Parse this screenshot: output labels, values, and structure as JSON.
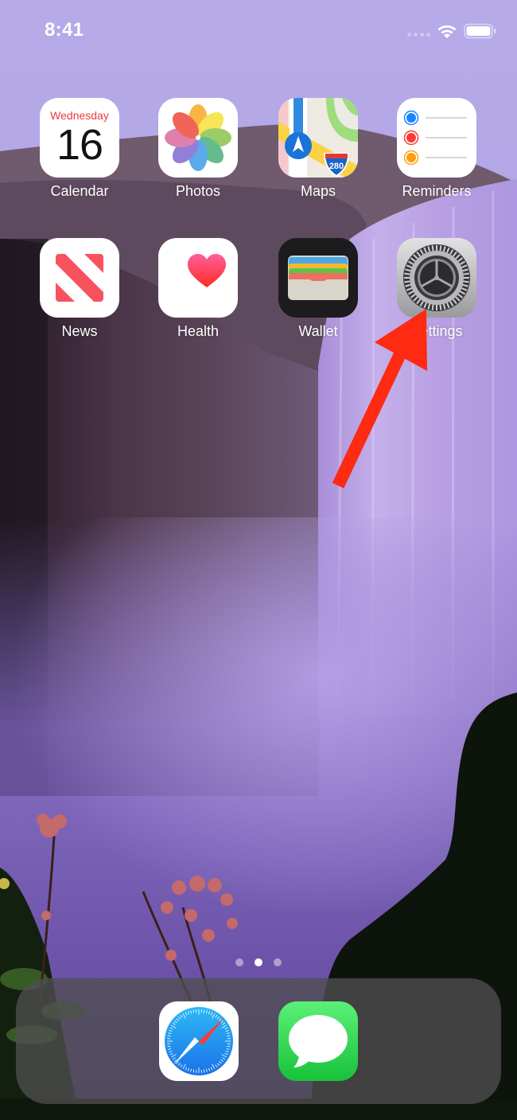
{
  "status_bar": {
    "time": "8:41",
    "signal_icon": "cellular-signal-icon",
    "wifi_icon": "wifi-icon",
    "battery_icon": "battery-icon",
    "battery_level": 1.0
  },
  "home_screen": {
    "apps": [
      {
        "label": "Calendar",
        "icon": "calendar-icon",
        "weekday": "Wednesday",
        "day": "16"
      },
      {
        "label": "Photos",
        "icon": "photos-icon"
      },
      {
        "label": "Maps",
        "icon": "maps-icon",
        "shield_text": "280"
      },
      {
        "label": "Reminders",
        "icon": "reminders-icon"
      },
      {
        "label": "News",
        "icon": "news-icon"
      },
      {
        "label": "Health",
        "icon": "health-icon"
      },
      {
        "label": "Wallet",
        "icon": "wallet-icon"
      },
      {
        "label": "Settings",
        "icon": "settings-icon"
      }
    ],
    "page_indicator": {
      "pages": 3,
      "current": 2
    }
  },
  "dock": {
    "apps": [
      {
        "label": "Safari",
        "icon": "safari-icon"
      },
      {
        "label": "Messages",
        "icon": "messages-icon"
      }
    ]
  },
  "annotation": {
    "type": "arrow",
    "target": "Settings",
    "color": "#ff2a12"
  },
  "colors": {
    "wallpaper_sky": "#b9aeea",
    "calendar_red": "#f2383a",
    "reminder_blue": "#1a84ff",
    "reminder_red": "#ff3b30",
    "reminder_orange": "#ff9f0a",
    "news_red": "#f9525f",
    "messages_green": "#34c759",
    "safari_blue": "#1e8cf0"
  }
}
